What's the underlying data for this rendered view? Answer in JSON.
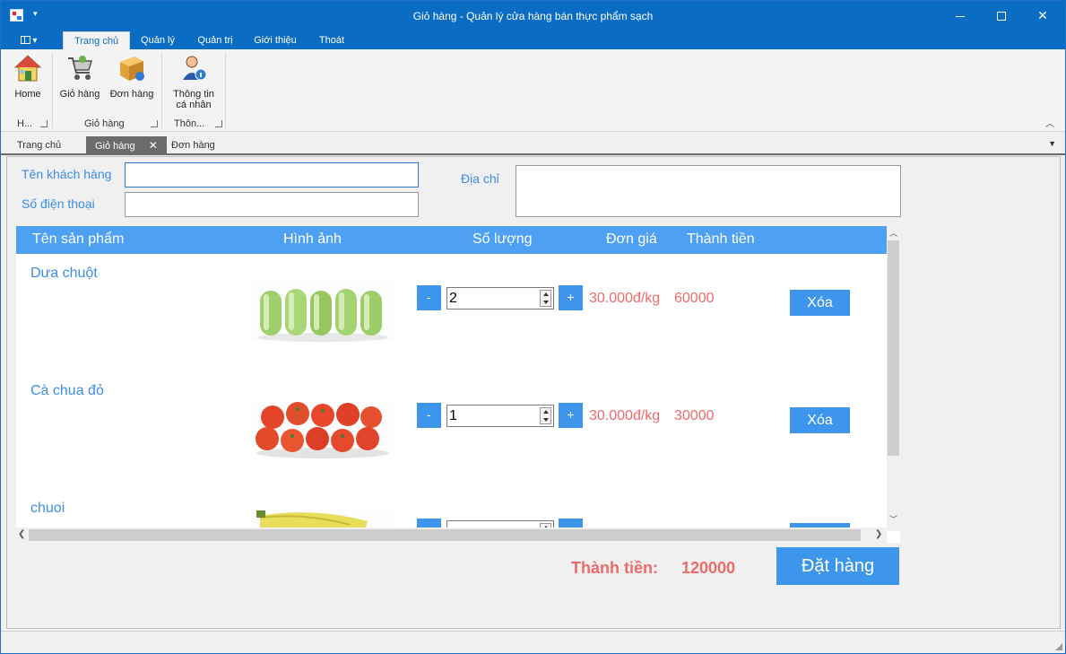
{
  "window": {
    "title": "Giỏ hàng - Quản lý cửa hàng bán thực phẩm sạch",
    "minimize": "",
    "maximize": "",
    "close": "✕"
  },
  "ribbon": {
    "file_menu_arrow": "▾",
    "tabs": [
      "Trang chủ",
      "Quản lý",
      "Quản trị",
      "Giới thiệu",
      "Thoát"
    ],
    "active_tab": "Trang chủ",
    "buttons": {
      "home": "Home",
      "cart": "Giỏ hàng",
      "orders": "Đơn hàng",
      "profile_line1": "Thông tin",
      "profile_line2": "cá nhân"
    },
    "groups": {
      "home": "H...",
      "cart": "Giỏ hàng",
      "info": "Thôn..."
    }
  },
  "doc_tabs": {
    "items": [
      "Trang chủ",
      "Giỏ hàng",
      "Đơn hàng"
    ],
    "active": "Giỏ hàng",
    "close_glyph": "✕"
  },
  "form": {
    "customer_name_label": "Tên khách hàng",
    "customer_name_value": "",
    "phone_label": "Số điện thoại",
    "phone_value": "",
    "address_label": "Địa chỉ",
    "address_value": ""
  },
  "grid": {
    "columns": [
      "Tên sản phẩm",
      "Hình ảnh",
      "Số lượng",
      "Đơn giá",
      "Thành tiền"
    ],
    "minus_label": "-",
    "plus_label": "+",
    "delete_label": "Xóa",
    "rows": [
      {
        "name": "Dưa chuột",
        "image": "cucumber-image",
        "qty": "2",
        "unit_price": "30.000đ/kg",
        "total": "60000"
      },
      {
        "name": "Cà chua đỏ",
        "image": "tomato-image",
        "qty": "1",
        "unit_price": "30.000đ/kg",
        "total": "30000"
      },
      {
        "name": "chuoi",
        "image": "banana-image",
        "qty": "",
        "unit_price": "",
        "total": ""
      }
    ]
  },
  "summary": {
    "total_label": "Thành tiền:",
    "total_value": "120000",
    "order_button": "Đặt hàng"
  },
  "colors": {
    "titlebar": "#0b6cc3",
    "accent_blue": "#3e96ec",
    "header_blue": "#4ea0f2",
    "label_blue": "#3c8de6",
    "price_red": "#ee6b6b"
  }
}
